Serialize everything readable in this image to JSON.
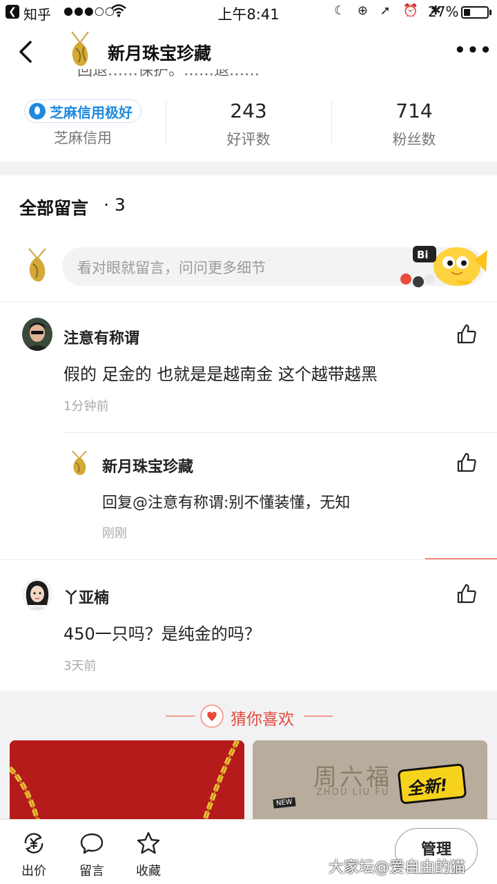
{
  "status_bar": {
    "back_app": "知乎",
    "signal": "●●●○○",
    "time": "上午8:41",
    "icons": "☾ ⊕ ➚ ⏰ ✱",
    "battery_text": "27%",
    "battery_level": 0.27
  },
  "nav": {
    "title": "新月珠宝珍藏",
    "more": "•••",
    "clipped_text": "回退……保护。……退……"
  },
  "stats": [
    {
      "value": "芝麻信用极好",
      "label": "芝麻信用"
    },
    {
      "value": "243",
      "label": "好评数"
    },
    {
      "value": "714",
      "label": "粉丝数"
    }
  ],
  "comments_header": {
    "title": "全部留言",
    "count": "· 3"
  },
  "comment_input": {
    "placeholder": "看对眼就留言，问问更多细节",
    "mascot_text": "Bi"
  },
  "comments": [
    {
      "author": "注意有称谓",
      "text": "假的 足金的 也就是是越南金 这个越带越黑",
      "time": "1分钟前"
    },
    {
      "author": "新月珠宝珍藏",
      "text": "回复@注意有称谓:别不懂装懂，无知",
      "time": "刚刚"
    },
    {
      "author": "丫亚楠",
      "text": "450一只吗？是纯金的吗？",
      "time": "3天前"
    }
  ],
  "recommend": {
    "heading": "猜你喜欢",
    "brand_cn": "周六福",
    "brand_en": "ZHOU LIU FU",
    "badge": "全新!",
    "badge_sub": "NEW"
  },
  "bottom_bar": {
    "items": [
      {
        "label": "出价",
        "icon": "yen-exchange-icon"
      },
      {
        "label": "留言",
        "icon": "chat-bubble-icon"
      },
      {
        "label": "收藏",
        "icon": "star-icon"
      }
    ],
    "manage_label": "管理"
  },
  "watermark": "大家坛@爱自由的猫",
  "colors": {
    "accent_red": "#e8483a",
    "sesame_blue": "#1d8ae0",
    "gold": "#c9a13a"
  }
}
